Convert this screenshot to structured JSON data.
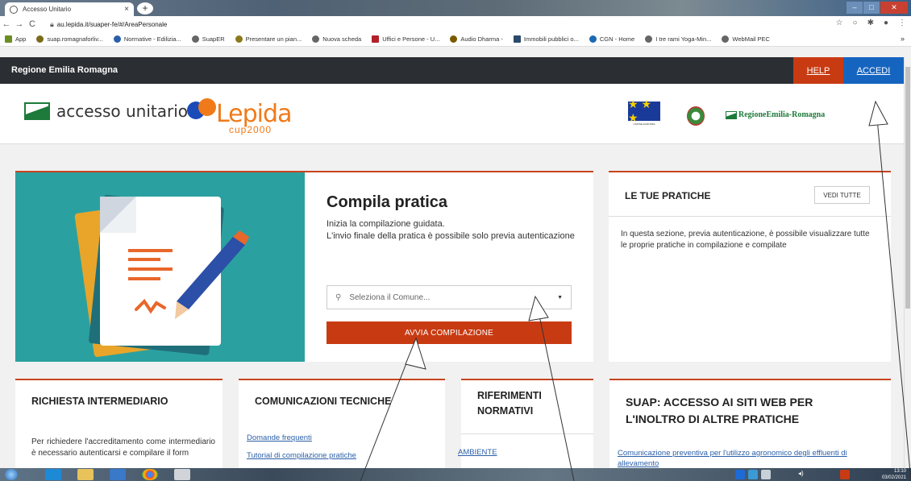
{
  "browser": {
    "tab_title": "Accesso Unitario",
    "tab_close": "×",
    "new_tab": "+",
    "url": "au.lepida.it/suaper-fe/#/AreaPersonale",
    "nav_back": "←",
    "nav_forward": "→",
    "nav_reload": "C",
    "bookmarks": [
      {
        "label": "App",
        "color": "#6b8e23"
      },
      {
        "label": "suap.romagnaforliv...",
        "color": "#7a6b1a"
      },
      {
        "label": "Normative - Edilizia...",
        "color": "#2a5fa8"
      },
      {
        "label": "SuapER",
        "color": "#666666"
      },
      {
        "label": "Presentare un pian...",
        "color": "#8a7a1a"
      },
      {
        "label": "Nuova scheda",
        "color": "#666666"
      },
      {
        "label": "Uffici e Persone - U...",
        "color": "#b3202a"
      },
      {
        "label": "Audio Dharma -",
        "color": "#7a5a00"
      },
      {
        "label": "Immobili pubblici o...",
        "color": "#2a4a6a"
      },
      {
        "label": "CGN - Home",
        "color": "#1a6ab3"
      },
      {
        "label": "I tre rami Yoga-Min...",
        "color": "#666666"
      },
      {
        "label": "WebMail PEC",
        "color": "#666666"
      }
    ],
    "bookmarks_more": "»"
  },
  "header": {
    "region": "Regione Emilia Romagna",
    "help": "HELP",
    "accedi": "ACCEDI"
  },
  "logos": {
    "accesso_unitario": "accesso unitario",
    "lepida": "Lepida",
    "lepida_sub": "cup2000",
    "eu_flag": "★ ★ ★",
    "eu_caption": "UNIONE EUROPEA",
    "rer": "RegioneEmilia-Romagna"
  },
  "hero": {
    "title": "Compila pratica",
    "text": "Inizia la compilazione guidata.\nL'invio finale della pratica è possibile solo previa autenticazione",
    "select_placeholder": "Seleziona il Comune...",
    "button": "AVVIA COMPILAZIONE"
  },
  "pratiche": {
    "title": "LE TUE PRATICHE",
    "button": "VEDI TUTTE",
    "text": "In questa sezione, previa autenticazione, è possibile visualizzare tutte le proprie pratiche in compilazione e compilate"
  },
  "cards": {
    "intermediario": {
      "title": "RICHIESTA INTERMEDIARIO",
      "text": "Per richiedere l'accreditamento come intermediario è necessario autenticarsi e compilare il form"
    },
    "comunicazioni": {
      "title": "COMUNICAZIONI TECNICHE",
      "links": [
        "Domande frequenti",
        "Tutorial di compilazione pratiche"
      ]
    },
    "riferimenti": {
      "title": "RIFERIMENTI NORMATIVI",
      "links": [
        "AMBIENTE"
      ]
    },
    "suap": {
      "title": "SUAP: ACCESSO AI SITI WEB PER L'INOLTRO DI ALTRE PRATICHE",
      "links": [
        "Comunicazione preventiva per l'utilizzo agronomico degli effluenti di allevamento"
      ]
    }
  },
  "taskbar": {
    "time": "13:10",
    "date": "03/02/2021"
  }
}
